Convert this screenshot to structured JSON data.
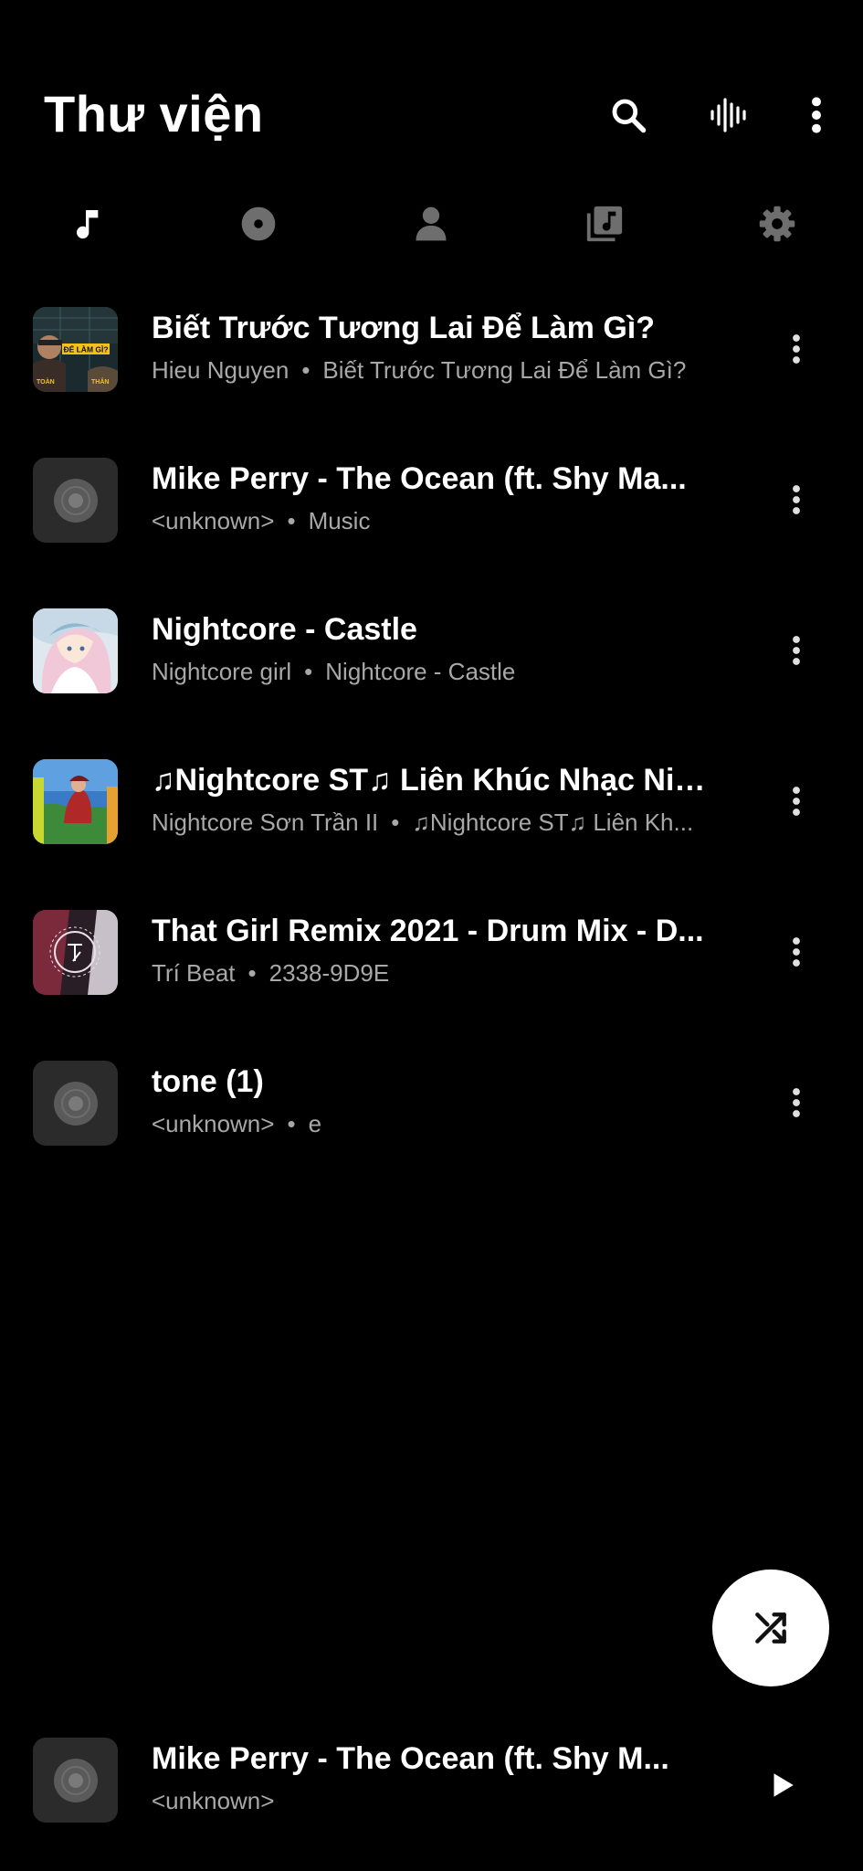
{
  "header": {
    "title": "Thư viện",
    "search_icon": "search-icon",
    "voice_icon": "waveform-icon",
    "more_icon": "more-vert-icon"
  },
  "tabs": [
    {
      "icon": "music-note-icon",
      "active": true
    },
    {
      "icon": "album-icon",
      "active": false
    },
    {
      "icon": "artist-icon",
      "active": false
    },
    {
      "icon": "playlist-icon",
      "active": false
    },
    {
      "icon": "settings-icon",
      "active": false
    }
  ],
  "songs": [
    {
      "title": "Biết Trước Tương Lai Để Làm Gì?",
      "artist": "Hieu Nguyen",
      "album": "Biết Trước Tương Lai Để Làm Gì?"
    },
    {
      "title": "Mike Perry - The Ocean (ft. Shy Ma...",
      "artist": "<unknown>",
      "album": "Music"
    },
    {
      "title": "Nightcore - Castle",
      "artist": "Nightcore girl",
      "album": "Nightcore - Castle"
    },
    {
      "title": "♫Nightcore ST♫ Liên Khúc Nhạc Nig...",
      "artist": "Nightcore Sơn Trần II",
      "album": "♫Nightcore ST♫ Liên Kh..."
    },
    {
      "title": "That Girl Remix 2021 - Drum Mix - D...",
      "artist": "Trí Beat",
      "album": "2338-9D9E"
    },
    {
      "title": "tone (1)",
      "artist": "<unknown>",
      "album": "e"
    }
  ],
  "separator": "•",
  "art_labels": {
    "song0_line1": "ĐỂ LÀM GÌ?",
    "song0_left": "TOÀN",
    "song0_right": "THẮN"
  },
  "shuffle_icon": "shuffle-icon",
  "now_playing": {
    "title": "Mike Perry - The Ocean (ft. Shy M...",
    "artist": "<unknown>",
    "play_icon": "play-icon"
  },
  "colors": {
    "background": "#000000",
    "primary_text": "#ffffff",
    "secondary_text": "#a8a8a8",
    "inactive_icon": "#6e6e6e",
    "placeholder_art": "#2b2b2b"
  }
}
